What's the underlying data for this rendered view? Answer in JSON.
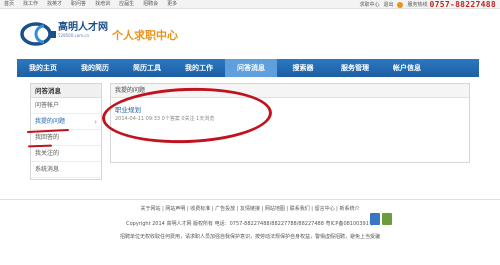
{
  "topbar": {
    "links": [
      "首页",
      "找工作",
      "找英才",
      "职问答",
      "找培训",
      "应届生",
      "招聘会",
      "更多"
    ],
    "right_links": [
      "求职中心",
      "退出",
      "服务热线"
    ],
    "phone": "0757-88227488"
  },
  "header": {
    "site_name": "高明人才网",
    "site_url": "528500.com.cn",
    "center_title": "个人求职中心"
  },
  "nav": {
    "items": [
      "我的主页",
      "我的简历",
      "简历工具",
      "我的工作",
      "问答消息",
      "搜索器",
      "服务管理",
      "帐户信息"
    ],
    "active_index": 4
  },
  "sidebar": {
    "title": "问答消息",
    "items": [
      "问答帐户",
      "我提的问题",
      "我回答的",
      "我关注的",
      "系统消息"
    ],
    "active_index": 1
  },
  "panel": {
    "title": "我提的问题",
    "question_title": "职业规划",
    "question_meta": "2014-04-11 09:33  0个答案  0关注  1天浏览"
  },
  "footer": {
    "links_line": "关于网站 | 网站声明 | 收费标准 | 广告投放 | 友情链接 | 网站地图 | 联系我们 | 留言中心 | 新系统介",
    "copyright_line": "Copyright 2014 高明人才网 版权所有  电话：0757-88227488/88227788/88227488  粤ICP备08100391号",
    "notice_line": "招聘单位无权收取任何费用，请求职人员加强自我保护意识，按劳动法规保护自身权益，警惕虚假招聘，避免上当受骗"
  },
  "colors": {
    "nav_bg": "#1d5fa3",
    "nav_active": "#5fa0dc",
    "accent_orange": "#e8931b",
    "annotation_red": "#c1121f"
  }
}
